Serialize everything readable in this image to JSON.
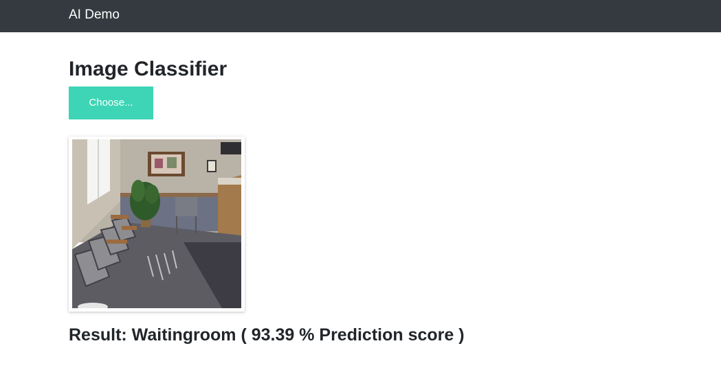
{
  "navbar": {
    "brand": "AI Demo"
  },
  "main": {
    "title": "Image Classifier",
    "choose_button_label": "Choose...",
    "result": {
      "label": "Waitingroom",
      "score_percent": 93.39,
      "text": "Result: Waitingroom ( 93.39 % Prediction score )"
    }
  },
  "colors": {
    "navbar_bg": "#343a40",
    "accent": "#3dd5b5",
    "text": "#212529"
  }
}
